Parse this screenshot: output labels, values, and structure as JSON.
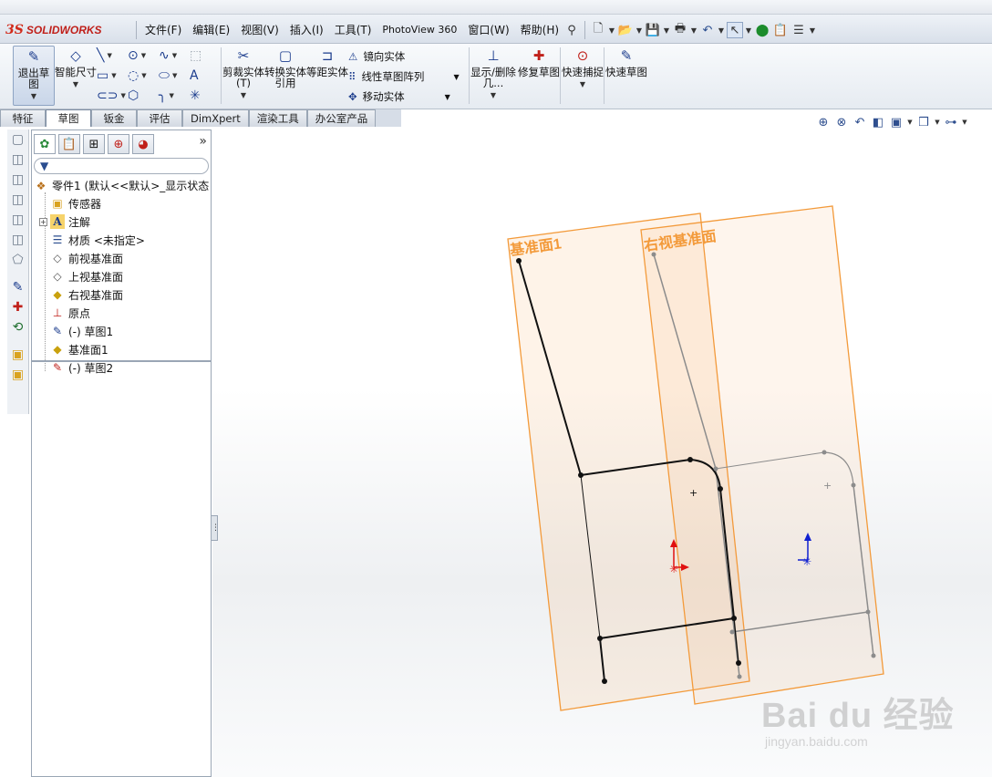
{
  "app": {
    "logo_prefix": "3S",
    "logo_name": "SOLIDWORKS"
  },
  "menu": {
    "items": [
      "文件(F)",
      "编辑(E)",
      "视图(V)",
      "插入(I)",
      "工具(T)",
      "PhotoView 360",
      "窗口(W)",
      "帮助(H)"
    ]
  },
  "ribbon": {
    "exit_sketch": "退出草图",
    "smart_dimension": "智能尺寸",
    "trim": "剪裁实体(T)",
    "convert": "转换实体引用",
    "offset": "等距实体",
    "mirror": "镜向实体",
    "linear_pattern": "线性草图阵列",
    "move": "移动实体",
    "display_delete": "显示/删除几...",
    "repair": "修复草图",
    "snap": "快速捕捉",
    "rapid_sketch": "快速草图"
  },
  "tabs": [
    "特征",
    "草图",
    "钣金",
    "评估",
    "DimXpert",
    "渲染工具",
    "办公室产品"
  ],
  "active_tab": "草图",
  "tree": {
    "root": "零件1 (默认<<默认>_显示状态",
    "items": [
      "传感器",
      "注解",
      "材质 <未指定>",
      "前视基准面",
      "上视基准面",
      "右视基准面",
      "原点",
      "(-) 草图1",
      "基准面1",
      "(-) 草图2"
    ]
  },
  "viewport": {
    "plane1_label": "基准面1",
    "plane2_label": "右视基准面",
    "plane_color": "#f39a3a",
    "sketch_color": "#111111",
    "ref_sketch_color": "#8c8c8c"
  },
  "watermark": {
    "main": "Bai du 经验",
    "sub": "jingyan.baidu.com"
  }
}
